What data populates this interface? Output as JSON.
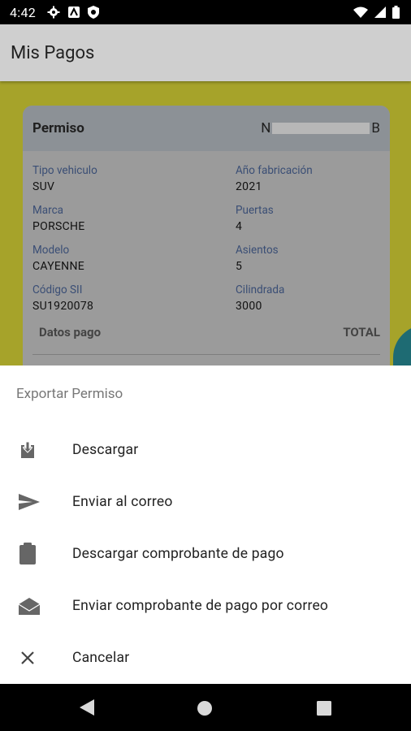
{
  "status": {
    "time": "4:42"
  },
  "app": {
    "title": "Mis Pagos"
  },
  "card": {
    "title": "Permiso",
    "plate_prefix": "N",
    "plate_suffix": "B",
    "fields": [
      {
        "label": "Tipo vehiculo",
        "value": "SUV"
      },
      {
        "label": "Año fabricación",
        "value": "2021"
      },
      {
        "label": "Marca",
        "value": "PORSCHE"
      },
      {
        "label": "Puertas",
        "value": "4"
      },
      {
        "label": "Modelo",
        "value": "CAYENNE"
      },
      {
        "label": "Asientos",
        "value": "5"
      },
      {
        "label": "Código SII",
        "value": "SU1920078"
      },
      {
        "label": "Cilindrada",
        "value": "3000"
      }
    ],
    "datos_pago": "Datos pago",
    "total": "TOTAL"
  },
  "sheet": {
    "title": "Exportar Permiso",
    "options": [
      {
        "label": "Descargar",
        "icon": "download-icon"
      },
      {
        "label": "Enviar al correo",
        "icon": "send-icon"
      },
      {
        "label": "Descargar comprobante de pago",
        "icon": "clipboard-icon"
      },
      {
        "label": "Enviar comprobante de pago por correo",
        "icon": "mail-open-icon"
      },
      {
        "label": "Cancelar",
        "icon": "close-icon"
      }
    ]
  }
}
